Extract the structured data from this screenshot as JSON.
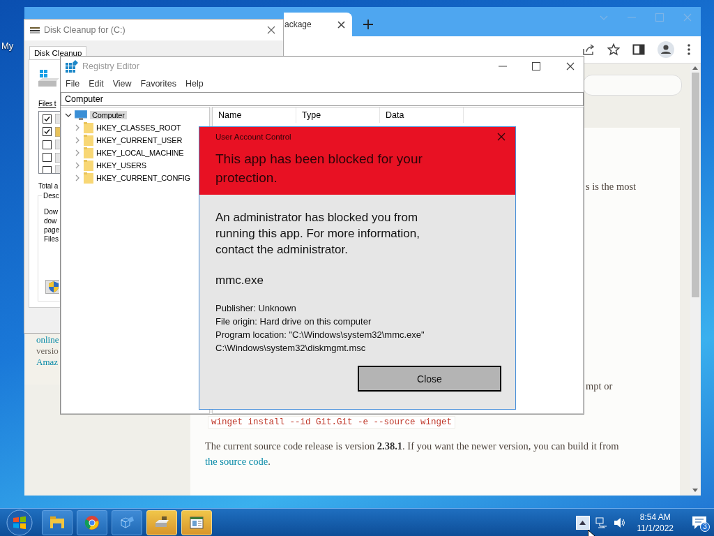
{
  "desktop": {
    "icon_label": "My"
  },
  "browser": {
    "tab": {
      "title": "ackage",
      "selected": true
    },
    "page": {
      "side_links": [
        {
          "text": "online",
          "kind": "link"
        },
        {
          "text": "versio",
          "kind": "text"
        },
        {
          "text": "Amaz",
          "kind": "link"
        }
      ],
      "fragment_1": "s is the most",
      "fragment_2": "mpt or",
      "command": "winget install --id Git.Git -e --source winget",
      "paragraph": "The current source code release is version **2.38.1**. If you want the newer version, you can build it from",
      "link": "the source code",
      "paragraph_end": "."
    }
  },
  "disk_cleanup": {
    "title": "Disk Cleanup for  (C:)",
    "tab": {
      "label": "Disk Cleanup",
      "selected": true
    },
    "files_label": "Files t",
    "items": [
      {
        "checked": true
      },
      {
        "checked": true
      },
      {
        "checked": false
      },
      {
        "checked": false
      },
      {
        "checked": false
      }
    ],
    "total_label": "Total a",
    "group_label": "Desc",
    "description_lines": [
      "Dow",
      "dow",
      "page",
      "Files"
    ]
  },
  "registry_editor": {
    "title": "Registry Editor",
    "menu": [
      "File",
      "Edit",
      "View",
      "Favorites",
      "Help"
    ],
    "address": "Computer",
    "tree": {
      "label": "Computer",
      "expanded": true,
      "selected": true,
      "children": [
        {
          "label": "HKEY_CLASSES_ROOT",
          "expanded": false,
          "selected": false
        },
        {
          "label": "HKEY_CURRENT_USER",
          "expanded": false,
          "selected": false
        },
        {
          "label": "HKEY_LOCAL_MACHINE",
          "expanded": false,
          "selected": false
        },
        {
          "label": "HKEY_USERS",
          "expanded": false,
          "selected": false
        },
        {
          "label": "HKEY_CURRENT_CONFIG",
          "expanded": false,
          "selected": false
        }
      ]
    },
    "columns": [
      "Name",
      "Type",
      "Data"
    ]
  },
  "uac": {
    "title": "User Account Control",
    "heading": "This app has been blocked for your protection.",
    "message": "An administrator has blocked you from running this app. For more information, contact the administrator.",
    "program": "mmc.exe",
    "details": [
      "Publisher: Unknown",
      "File origin: Hard drive on this computer",
      "Program location: \"C:\\Windows\\system32\\mmc.exe\" C:\\Windows\\system32\\diskmgmt.msc"
    ],
    "button": "Close"
  },
  "taskbar": {
    "pinned": [
      {
        "highlighted": false
      },
      {
        "highlighted": false
      },
      {
        "highlighted": false
      },
      {
        "highlighted": true
      },
      {
        "highlighted": true
      }
    ],
    "time": "8:54 AM",
    "date": "11/1/2022",
    "notifications": "3"
  }
}
